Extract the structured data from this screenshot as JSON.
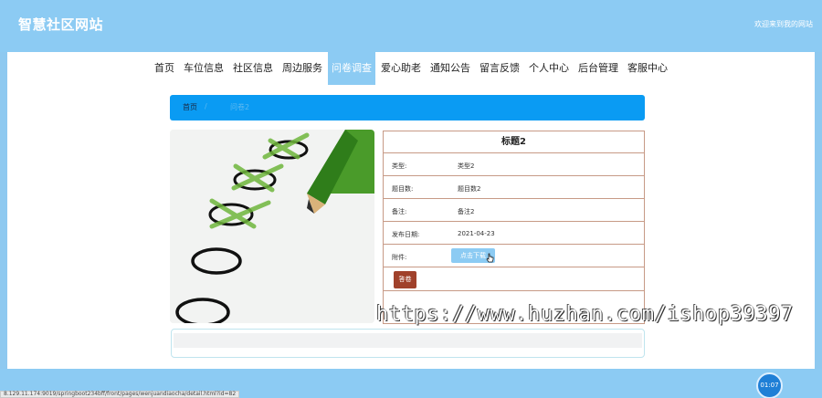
{
  "header": {
    "site_title": "智慧社区网站",
    "welcome": "欢迎来到我的网站"
  },
  "nav": {
    "items": [
      "首页",
      "车位信息",
      "社区信息",
      "周边服务",
      "问卷调查",
      "爱心助老",
      "通知公告",
      "留言反馈",
      "个人中心",
      "后台管理",
      "客服中心"
    ],
    "active": "问卷调查"
  },
  "breadcrumb": {
    "home": "首页",
    "separator": "/",
    "current": "问卷2"
  },
  "image": {
    "subject": "checklist-with-pencil-checkmarks"
  },
  "detail": {
    "title": "标题2",
    "rows": [
      {
        "label": "类型:",
        "value": "类型2"
      },
      {
        "label": "题目数:",
        "value": "题目数2"
      },
      {
        "label": "备注:",
        "value": "备注2"
      },
      {
        "label": "发布日期:",
        "value": "2021-04-23"
      }
    ],
    "attachment_label": "附件:",
    "download_button": "点击下载",
    "answer_button": "答卷"
  },
  "watermark": "https://www.huzhan.com/ishop39397",
  "clock": "01:07",
  "status_url": "8.129.11.174:9019/springboot234bff/front/pages/wenjuandiaocha/detail.html?id=82",
  "colors": {
    "header_bg": "#8ccbf3",
    "breadcrumb_bg": "#0a9bf3",
    "detail_border": "#c79a86",
    "answer_button": "#a0412b"
  }
}
